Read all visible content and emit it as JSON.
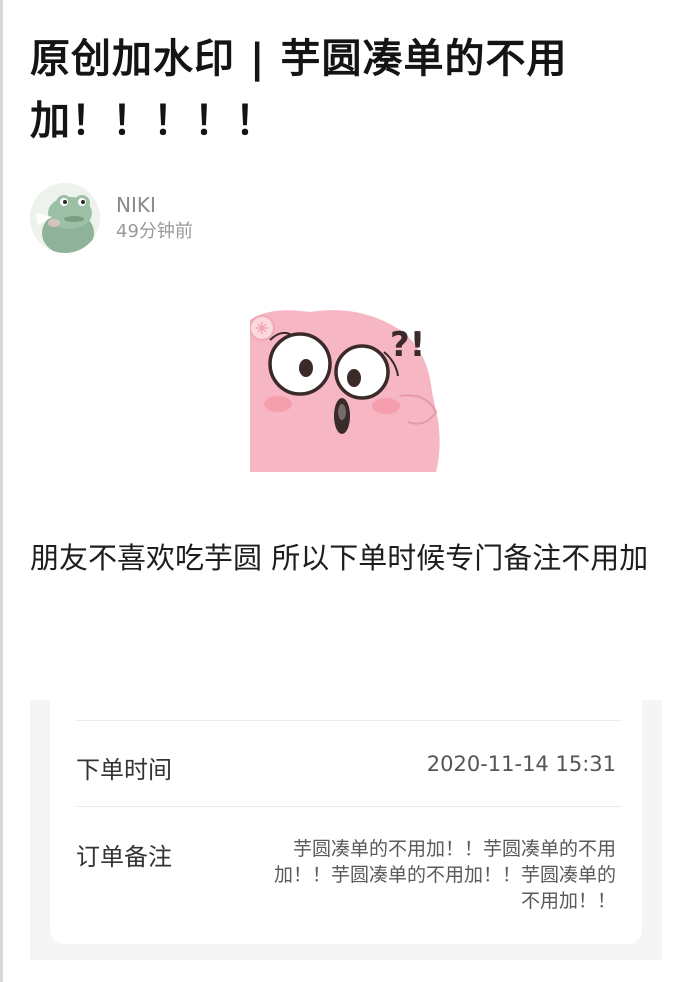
{
  "post": {
    "title": "原创加水印 | 芋圆凑单的不用加！！！！！",
    "body": "朋友不喜欢吃芋圆 所以下单时候专门备注不用加"
  },
  "author": {
    "name": "NIKI",
    "time": "49分钟前",
    "avatar_icon": "frog-avatar-icon"
  },
  "sticker": {
    "icon": "surprised-pink-face-sticker",
    "text": "?!"
  },
  "order": {
    "time_label": "下单时间",
    "time_value": "2020-11-14 15:31",
    "note_label": "订单备注",
    "note_value": "芋圆凑单的不用加！！芋圆凑单的不用加！！芋圆凑单的不用加！！芋圆凑单的不用加！！"
  },
  "colors": {
    "sticker_pink": "#f7b6c4",
    "avatar_green": "#8fb39a",
    "card_bg": "#f5f5f5"
  }
}
